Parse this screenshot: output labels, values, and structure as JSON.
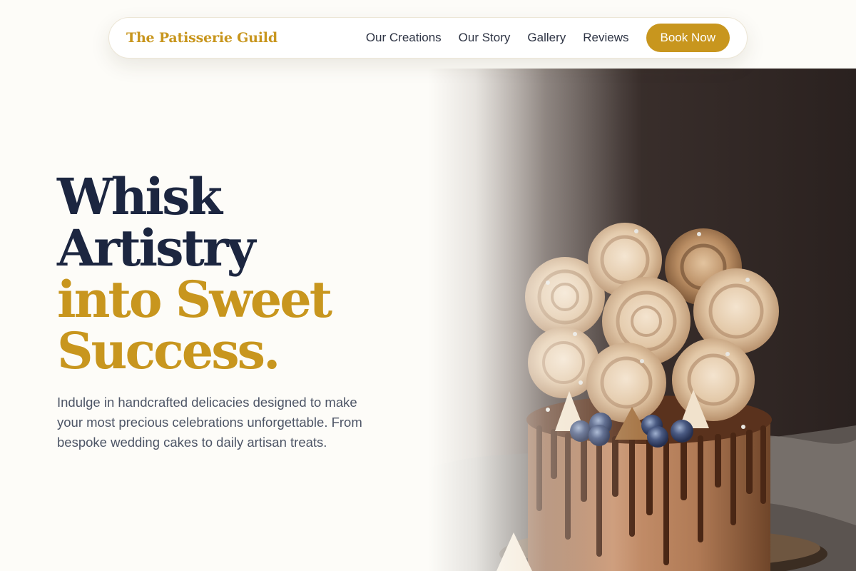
{
  "nav": {
    "brand": "The Patisserie Guild",
    "links": [
      "Our Creations",
      "Our Story",
      "Gallery",
      "Reviews"
    ],
    "cta": "Book Now"
  },
  "hero": {
    "headline_lines": [
      "Whisk",
      "Artistry",
      "into Sweet",
      "Success."
    ],
    "subcopy": "Indulge in handcrafted delicacies designed to make your most precious celebrations unforgettable. From bespoke wedding cakes to daily artisan treats.",
    "image_alt": "chocolate drip cake topped with meringue rosettes and blueberries"
  },
  "colors": {
    "accent_gold": "#c8961e",
    "heading_navy": "#1c2640",
    "body_text": "#4d5566",
    "page_bg": "#fdfcf8"
  }
}
